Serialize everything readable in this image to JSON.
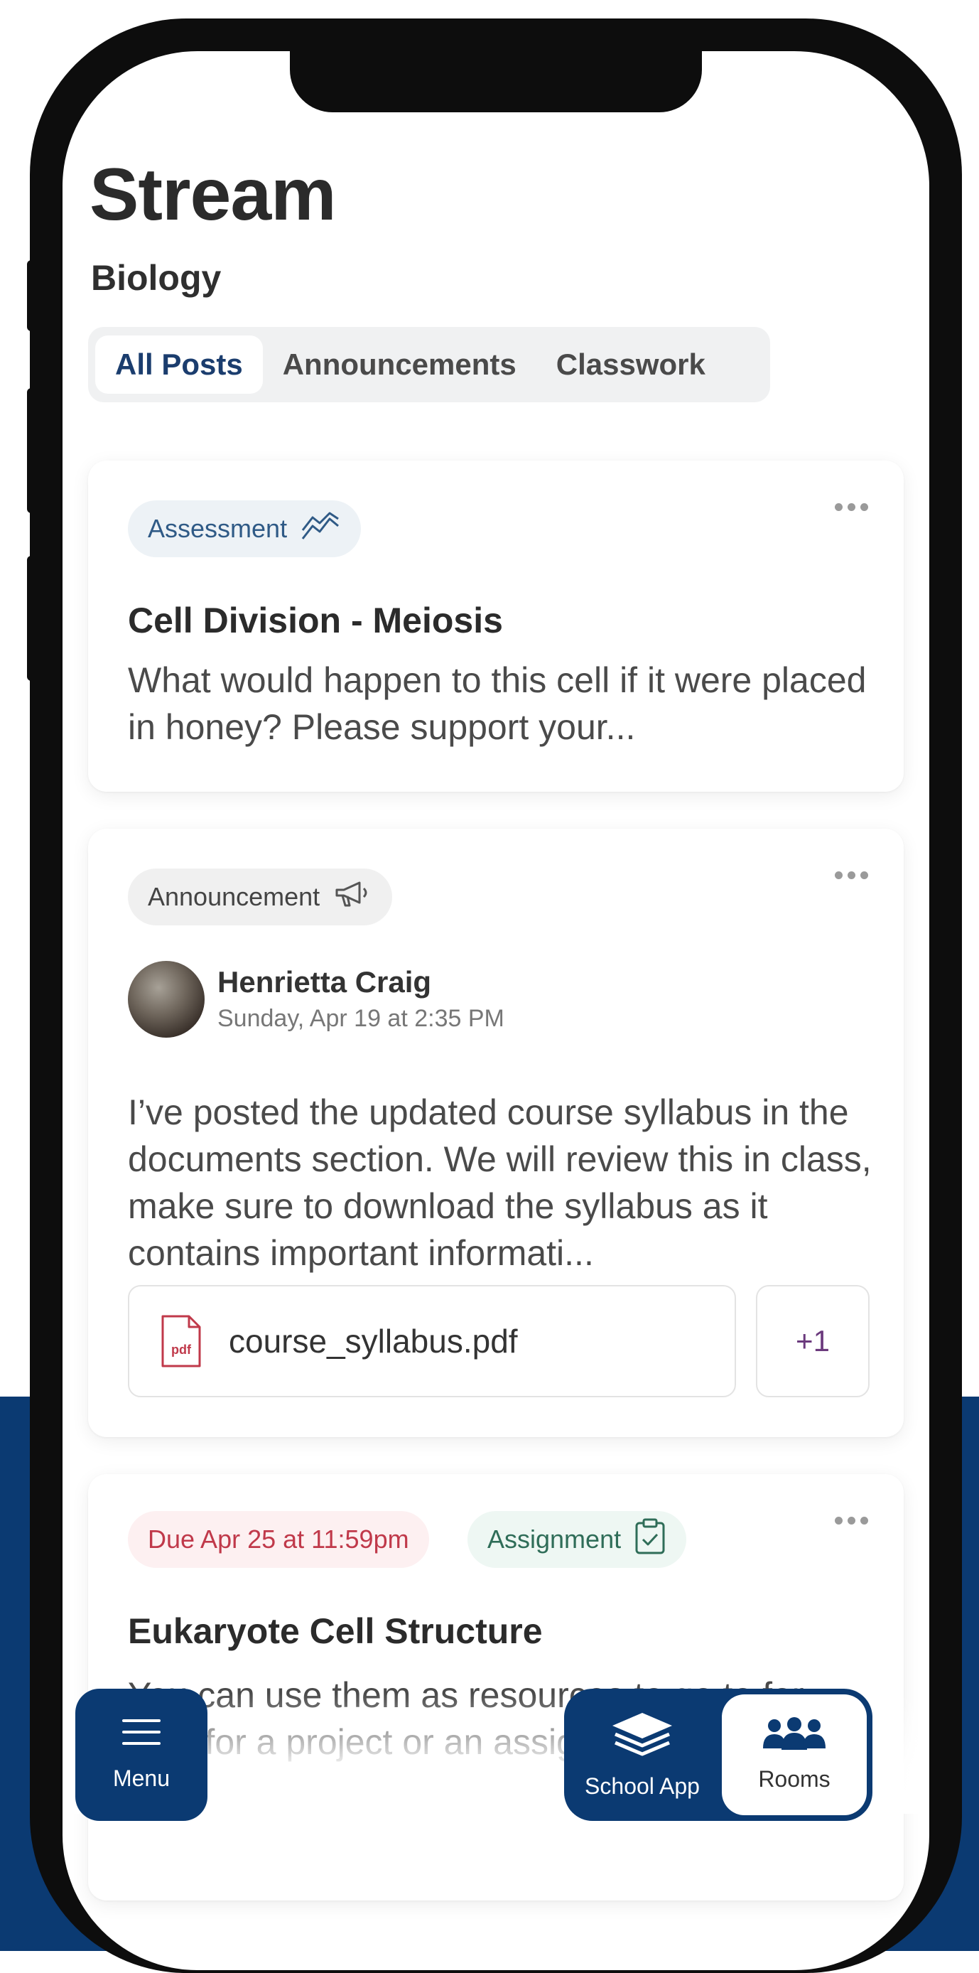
{
  "header": {
    "title": "Stream",
    "subtitle": "Biology"
  },
  "tabs": [
    {
      "label": "All Posts",
      "active": true
    },
    {
      "label": "Announcements",
      "active": false
    },
    {
      "label": "Classwork",
      "active": false
    }
  ],
  "posts": [
    {
      "tag": "Assessment",
      "tag_icon": "trend-chart-icon",
      "title": "Cell Division - Meiosis",
      "body": "What would happen to this cell if it were placed in honey? Please support your..."
    },
    {
      "tag": "Announcement",
      "tag_icon": "megaphone-icon",
      "author": "Henrietta Craig",
      "date": "Sunday, Apr 19 at 2:35 PM",
      "body": "I’ve posted the updated course syllabus in the documents section. We will review this in class, make sure to download the syllabus as it contains important informati...",
      "attachment": {
        "icon_label": "pdf",
        "name": "course_syllabus.pdf",
        "more": "+1"
      }
    },
    {
      "due": "Due Apr 25 at 11:59pm",
      "tag": "Assignment",
      "tag_icon": "clipboard-check-icon",
      "title": "Eukaryote Cell Structure",
      "body": "You can use them as resources to go to for help for a project or an assignment. The"
    }
  ],
  "bottom_nav": {
    "menu_label": "Menu",
    "school_app_label": "School App",
    "rooms_label": "Rooms"
  },
  "colors": {
    "brand": "#0b3a72",
    "assessment": "#2f5a86",
    "due": "#c0394a",
    "assignment": "#2f6d58",
    "pdf": "#c0394a"
  }
}
